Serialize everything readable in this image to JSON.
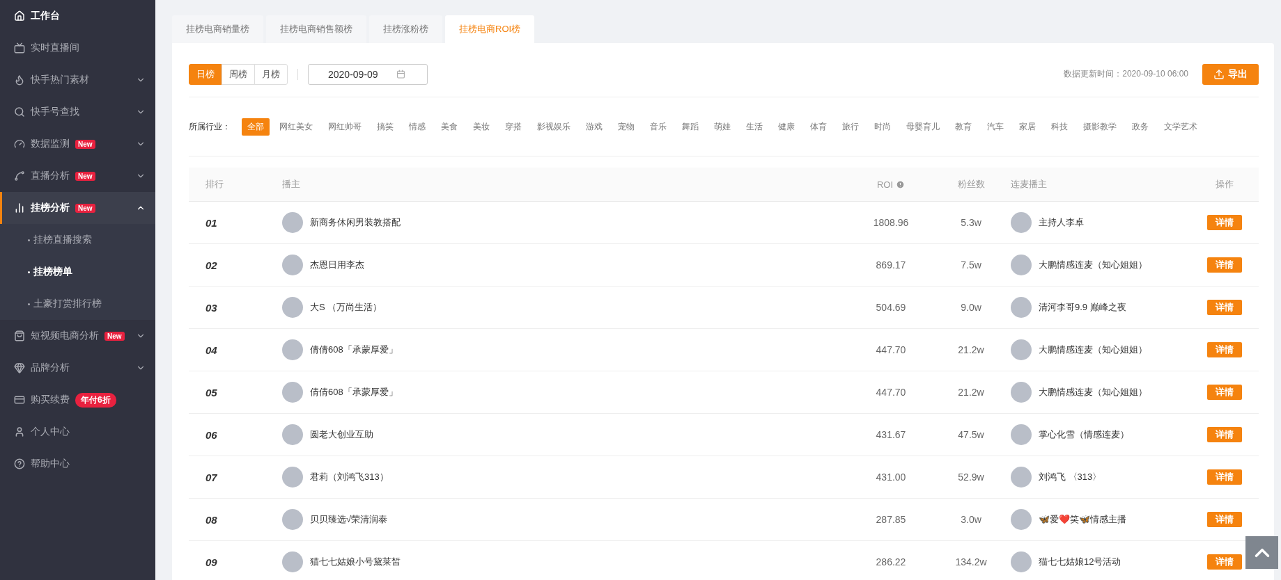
{
  "sidebar": {
    "items": [
      {
        "label": "工作台",
        "selected": false,
        "emphasis": true
      },
      {
        "label": "实时直播间",
        "selected": false
      },
      {
        "label": "快手热门素材",
        "selected": false,
        "expanded": false
      },
      {
        "label": "快手号查找",
        "selected": false,
        "expanded": false
      },
      {
        "label": "数据监测",
        "selected": false,
        "expanded": false,
        "badge": {
          "text": "New",
          "kind": "tag"
        }
      },
      {
        "label": "直播分析",
        "selected": false,
        "expanded": false,
        "badge": {
          "text": "New",
          "kind": "tag"
        }
      },
      {
        "label": "挂榜分析",
        "selected": true,
        "expanded": true,
        "badge": {
          "text": "New",
          "kind": "tag"
        },
        "children": [
          {
            "label": "挂榜直播搜索",
            "selected": false
          },
          {
            "label": "挂榜榜单",
            "selected": true
          },
          {
            "label": "土豪打赏排行榜",
            "selected": false
          }
        ]
      },
      {
        "label": "短视频电商分析",
        "selected": false,
        "expanded": false,
        "badge": {
          "text": "New",
          "kind": "tag"
        }
      },
      {
        "label": "品牌分析",
        "selected": false,
        "expanded": false
      },
      {
        "label": "购买续费",
        "selected": false,
        "badge": {
          "text": "年付6折",
          "kind": "pill"
        }
      },
      {
        "label": "个人中心",
        "selected": false
      },
      {
        "label": "帮助中心",
        "selected": false
      }
    ]
  },
  "tabs": [
    {
      "label": "挂榜电商销量榜",
      "selected": false
    },
    {
      "label": "挂榜电商销售额榜",
      "selected": false
    },
    {
      "label": "挂榜涨粉榜",
      "selected": false
    },
    {
      "label": "挂榜电商ROI榜",
      "selected": true
    }
  ],
  "toolbar": {
    "periods": [
      {
        "label": "日榜",
        "selected": true
      },
      {
        "label": "周榜",
        "selected": false
      },
      {
        "label": "月榜",
        "selected": false
      }
    ],
    "date": {
      "value": "2020-09-09"
    },
    "update_time": "数据更新时间：2020-09-10 06:00",
    "export_button": "导出"
  },
  "industry": {
    "label": "所属行业：",
    "tags": [
      {
        "label": "全部",
        "selected": true
      },
      {
        "label": "网红美女",
        "selected": false
      },
      {
        "label": "网红帅哥",
        "selected": false
      },
      {
        "label": "搞笑",
        "selected": false
      },
      {
        "label": "情感",
        "selected": false
      },
      {
        "label": "美食",
        "selected": false
      },
      {
        "label": "美妆",
        "selected": false
      },
      {
        "label": "穿搭",
        "selected": false
      },
      {
        "label": "影视娱乐",
        "selected": false
      },
      {
        "label": "游戏",
        "selected": false
      },
      {
        "label": "宠物",
        "selected": false
      },
      {
        "label": "音乐",
        "selected": false
      },
      {
        "label": "舞蹈",
        "selected": false
      },
      {
        "label": "萌娃",
        "selected": false
      },
      {
        "label": "生活",
        "selected": false
      },
      {
        "label": "健康",
        "selected": false
      },
      {
        "label": "体育",
        "selected": false
      },
      {
        "label": "旅行",
        "selected": false
      },
      {
        "label": "时尚",
        "selected": false
      },
      {
        "label": "母婴育儿",
        "selected": false
      },
      {
        "label": "教育",
        "selected": false
      },
      {
        "label": "汽车",
        "selected": false
      },
      {
        "label": "家居",
        "selected": false
      },
      {
        "label": "科技",
        "selected": false
      },
      {
        "label": "摄影教学",
        "selected": false
      },
      {
        "label": "政务",
        "selected": false
      },
      {
        "label": "文学艺术",
        "selected": false
      }
    ]
  },
  "table": {
    "columns": [
      "排行",
      "播主",
      "ROI",
      "粉丝数",
      "连麦播主",
      "操作"
    ],
    "rows": [
      {
        "rank": "01",
        "anchor": "新商务休闲男装教搭配",
        "roi": "1808.96",
        "fans": "5.3w",
        "partner": "主持人李卓",
        "action": "详情"
      },
      {
        "rank": "02",
        "anchor": "杰恩日用李杰",
        "roi": "869.17",
        "fans": "7.5w",
        "partner": "大鹏情感连麦（知心姐姐）",
        "action": "详情"
      },
      {
        "rank": "03",
        "anchor": "大S （万尚生活）",
        "roi": "504.69",
        "fans": "9.0w",
        "partner": "清河李哥9.9 巅峰之夜",
        "action": "详情"
      },
      {
        "rank": "04",
        "anchor": "倩倩608「承蒙厚爱」",
        "roi": "447.70",
        "fans": "21.2w",
        "partner": "大鹏情感连麦（知心姐姐）",
        "action": "详情"
      },
      {
        "rank": "05",
        "anchor": "倩倩608「承蒙厚爱」",
        "roi": "447.70",
        "fans": "21.2w",
        "partner": "大鹏情感连麦（知心姐姐）",
        "action": "详情"
      },
      {
        "rank": "06",
        "anchor": "圆老大创业互助",
        "roi": "431.67",
        "fans": "47.5w",
        "partner": "掌心化雪（情感连麦）",
        "action": "详情"
      },
      {
        "rank": "07",
        "anchor": "君莉（刘鸿飞313）",
        "roi": "431.00",
        "fans": "52.9w",
        "partner": "刘鸿飞 〈313〉",
        "action": "详情"
      },
      {
        "rank": "08",
        "anchor": "贝贝臻选√荣清润泰",
        "roi": "287.85",
        "fans": "3.0w",
        "partner": "🦋爱❤️笑🦋情感主播",
        "action": "详情"
      },
      {
        "rank": "09",
        "anchor": "猫七七姑娘小号黛莱皙",
        "roi": "286.22",
        "fans": "134.2w",
        "partner": "猫七七姑娘12号活动",
        "action": "详情"
      }
    ]
  }
}
